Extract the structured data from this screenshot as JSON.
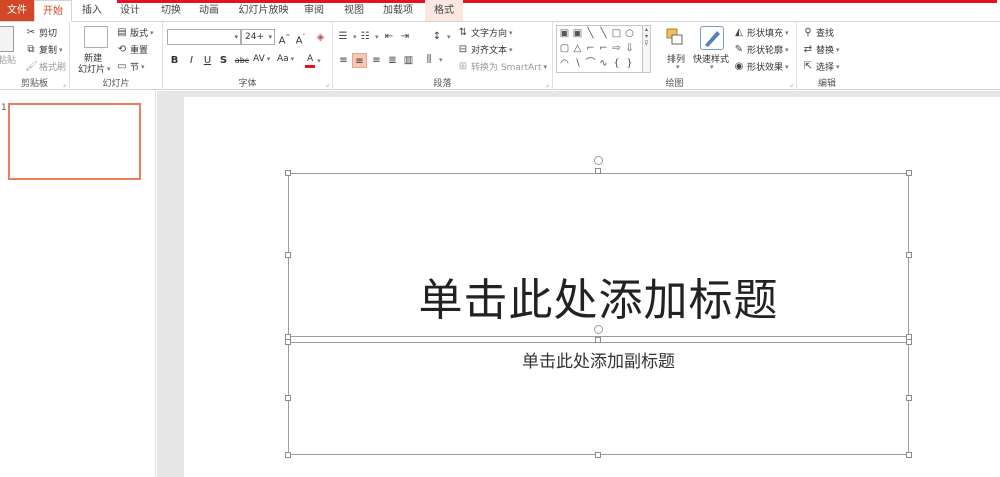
{
  "tabs": {
    "file": "文件",
    "home": "开始",
    "insert": "插入",
    "design": "设计",
    "transitions": "切换",
    "animations": "动画",
    "slideshow": "幻灯片放映",
    "review": "审阅",
    "view": "视图",
    "addins": "加载项",
    "format": "格式"
  },
  "ribbon": {
    "clipboard": {
      "label": "剪贴板",
      "paste": "粘贴",
      "cut": "剪切",
      "copy": "复制",
      "format_painter": "格式刷"
    },
    "slides": {
      "label": "幻灯片",
      "new_slide_line1": "新建",
      "new_slide_line2": "幻灯片",
      "layout": "版式",
      "reset": "重置",
      "section": "节"
    },
    "font": {
      "label": "字体",
      "font_name": "",
      "font_size": "24+",
      "bold": "B",
      "italic": "I",
      "underline": "U",
      "shadow": "S",
      "strike": "abc",
      "spacing": "AV",
      "case": "Aa",
      "color": "A"
    },
    "paragraph": {
      "label": "段落",
      "text_direction": "文字方向",
      "align_text": "对齐文本",
      "smartart": "转换为 SmartArt"
    },
    "drawing": {
      "label": "绘图",
      "arrange": "排列",
      "quick_styles": "快速样式",
      "shape_fill": "形状填充",
      "shape_outline": "形状轮廓",
      "shape_effects": "形状效果"
    },
    "editing": {
      "label": "编辑",
      "find": "查找",
      "replace": "替换",
      "select": "选择"
    }
  },
  "thumbnails": {
    "slide_number": "1"
  },
  "slide": {
    "title_placeholder": "单击此处添加标题",
    "subtitle_placeholder": "单击此处添加副标题"
  },
  "colors": {
    "accent": "#d24726",
    "contextual_tab_bar": "#e81123",
    "thumbnail_border": "#e97e5c"
  }
}
